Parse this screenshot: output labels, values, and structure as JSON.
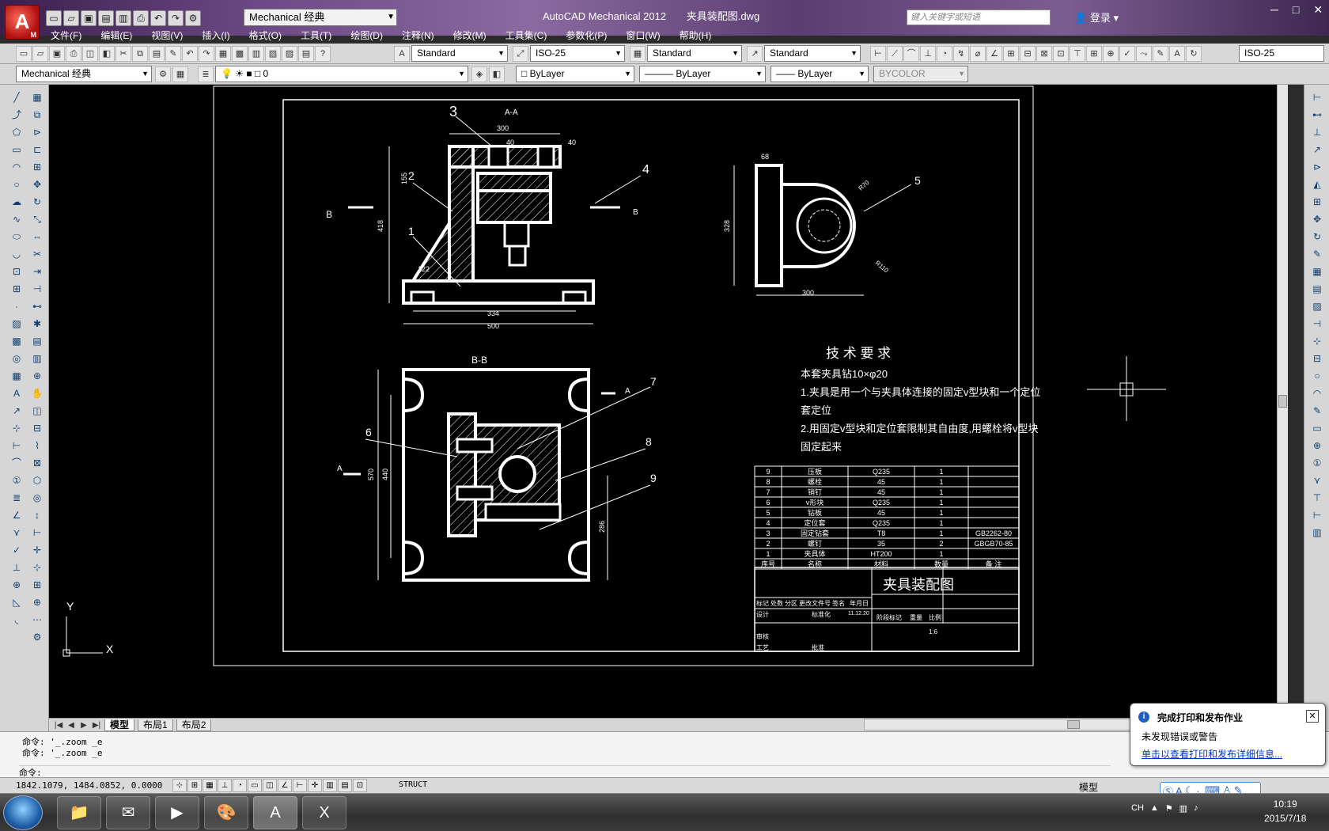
{
  "window": {
    "app_name": "AutoCAD Mechanical 2012",
    "file_name": "夹具装配图.dwg",
    "workspace": "Mechanical 经典",
    "search_placeholder": "键入关键字或短语",
    "login": "登录",
    "controls": [
      "─",
      "□",
      "✕"
    ]
  },
  "menu": [
    "文件(F)",
    "编辑(E)",
    "视图(V)",
    "插入(I)",
    "格式(O)",
    "工具(T)",
    "绘图(D)",
    "注释(N)",
    "修改(M)",
    "工具集(C)",
    "参数化(P)",
    "窗口(W)",
    "帮助(H)"
  ],
  "styles_toolbar": {
    "text_style": "Standard",
    "dim_style": "ISO-25",
    "table_style": "Standard",
    "mleader_style": "Standard",
    "dim_style_right": "ISO-25"
  },
  "layers_toolbar": {
    "workspace": "Mechanical 经典",
    "layer": "0",
    "color": "ByLayer",
    "linetype": "ByLayer",
    "lineweight": "ByLayer",
    "plotstyle": "BYCOLOR"
  },
  "drawing": {
    "section_aa": "A-A",
    "section_bb": "B-B",
    "b_left": "B",
    "b_right": "B",
    "a_left": "A",
    "a_right": "A",
    "dims_top": [
      "300",
      "40",
      "40",
      "155",
      "418",
      "122",
      "334",
      "500"
    ],
    "dims_right_view": [
      "68",
      "328",
      "300",
      "R70",
      "R110"
    ],
    "dims_bottom": [
      "570",
      "440",
      "286"
    ],
    "balloons": [
      "1",
      "2",
      "3",
      "4",
      "5",
      "6",
      "7",
      "8",
      "9"
    ],
    "tech_title": "技 术 要 求",
    "tech_lines": [
      "本套夹具钻10×φ20",
      "1.夹具是用一个与夹具体连接的固定v型块和一个定位",
      "套定位",
      "2.用固定v型块和定位套限制其自由度,用螺栓将v型块",
      "固定起来"
    ],
    "bom": [
      [
        "9",
        "压板",
        "Q235",
        "1",
        ""
      ],
      [
        "8",
        "螺栓",
        "45",
        "1",
        ""
      ],
      [
        "7",
        "销钉",
        "45",
        "1",
        ""
      ],
      [
        "6",
        "v形块",
        "Q235",
        "1",
        ""
      ],
      [
        "5",
        "钻板",
        "45",
        "1",
        ""
      ],
      [
        "4",
        "定位套",
        "Q235",
        "1",
        ""
      ],
      [
        "3",
        "固定钻套",
        "T8",
        "1",
        "GB2262-80"
      ],
      [
        "2",
        "螺钉",
        "35",
        "2",
        "GBGB70-85"
      ],
      [
        "1",
        "夹具体",
        "HT200",
        "1",
        ""
      ]
    ],
    "bom_header": [
      "序号",
      "名称",
      "材料",
      "数量",
      "备 注"
    ],
    "title_block": {
      "title": "夹具装配图",
      "labels": [
        "标记",
        "处数",
        "分区",
        "更改文件号",
        "签名",
        "年月日",
        "设计",
        "标准化",
        "阶段标记",
        "重量",
        "比例",
        "审核",
        "工艺",
        "批准"
      ],
      "scale": "1:6",
      "date": "11.12.20"
    }
  },
  "tabs": [
    "模型",
    "布局1",
    "布局2"
  ],
  "command": {
    "lines": [
      "命令: '_.zoom _e",
      "命令: '_.zoom _e"
    ],
    "prompt": "命令:"
  },
  "status": {
    "coords": "1842.1079, 1484.0852, 0.0000",
    "struct": "STRUCT",
    "model": "模型"
  },
  "notification": {
    "title": "完成打印和发布作业",
    "body": "未发现错误或警告",
    "link": "单击以查看打印和发布详细信息..."
  },
  "taskbar": {
    "lang": "CH",
    "time": "10:19",
    "date": "2015/7/18"
  }
}
